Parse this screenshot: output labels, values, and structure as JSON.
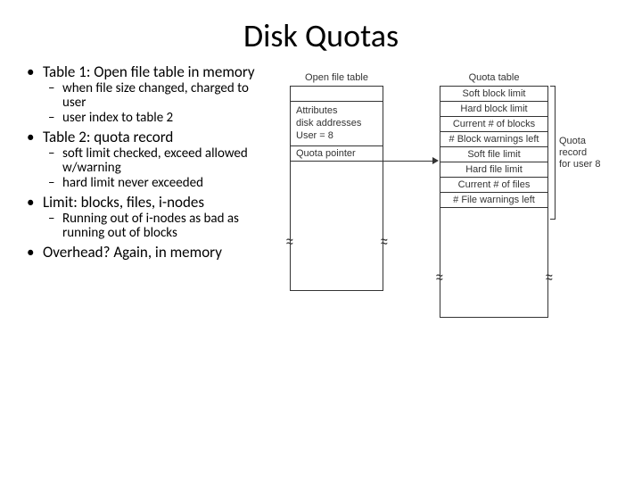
{
  "title": "Disk Quotas",
  "bullets": {
    "b1": "Table 1: Open file table in memory",
    "b1_1": "when file size changed, charged to user",
    "b1_2": "user index to table 2",
    "b2": "Table 2:  quota record",
    "b2_1": "soft limit checked, exceed allowed w/warning",
    "b2_2": "hard limit never exceeded",
    "b3": "Limit: blocks, files, i-nodes",
    "b3_1": "Running out of i-nodes as bad as running out of blocks",
    "b4": "Overhead?  Again, in memory"
  },
  "diagram": {
    "open_file_table_title": "Open file table",
    "quota_table_title": "Quota table",
    "attr1": "Attributes",
    "attr2": "disk addresses",
    "attr3": "User = 8",
    "quota_pointer": "Quota pointer",
    "q1": "Soft block limit",
    "q2": "Hard block limit",
    "q3": "Current # of blocks",
    "q4": "# Block warnings left",
    "q5": "Soft file limit",
    "q6": "Hard file limit",
    "q7": "Current # of files",
    "q8": "# File warnings left",
    "bracket_label1": "Quota",
    "bracket_label2": "record",
    "bracket_label3": "for user 8",
    "approx": "≈"
  }
}
